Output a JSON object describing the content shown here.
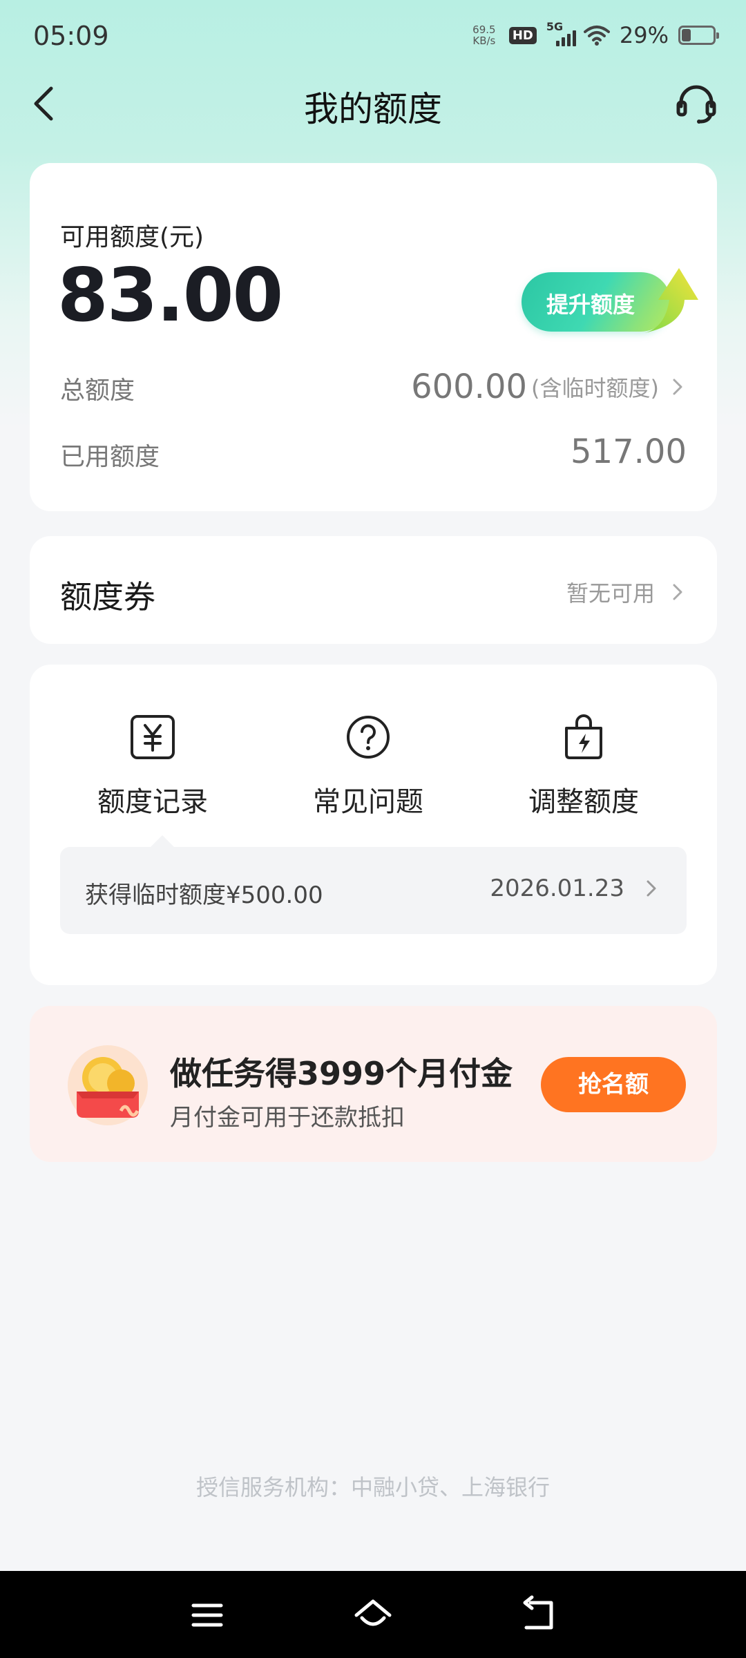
{
  "status_bar": {
    "time": "05:09",
    "net_speed_value": "69.5",
    "net_speed_unit": "KB/s",
    "hd_badge": "HD",
    "network_type": "5G",
    "battery_percent": "29%",
    "battery_level": 0.29
  },
  "nav": {
    "title": "我的额度",
    "back_icon": "chevron-left-icon",
    "support_icon": "headset-icon"
  },
  "quota": {
    "available_label": "可用额度(元)",
    "available_amount": "83.00",
    "raise_button_label": "提升额度",
    "total_label": "总额度",
    "total_value": "600.00",
    "total_note": "(含临时额度)",
    "used_label": "已用额度",
    "used_value": "517.00"
  },
  "coupon": {
    "title": "额度券",
    "status": "暂无可用"
  },
  "menu": {
    "items": [
      {
        "label": "额度记录",
        "icon": "yuan-receipt-icon"
      },
      {
        "label": "常见问题",
        "icon": "question-circle-icon"
      },
      {
        "label": "调整额度",
        "icon": "lightning-bag-icon"
      }
    ],
    "record": {
      "text": "获得临时额度¥500.00",
      "date": "2026.01.23"
    }
  },
  "promo": {
    "title": "做任务得3999个月付金",
    "subtitle": "月付金可用于还款抵扣",
    "button_label": "抢名额",
    "icon": "coin-wallet-icon"
  },
  "footer": {
    "note": "授信服务机构：中融小贷、上海银行"
  },
  "system_nav": {
    "icons": [
      "menu-icon",
      "home-icon",
      "back-icon"
    ]
  },
  "colors": {
    "accent_green": "#2cc7a4",
    "promo_orange": "#ff7421",
    "page_bg": "#f5f6f8"
  }
}
